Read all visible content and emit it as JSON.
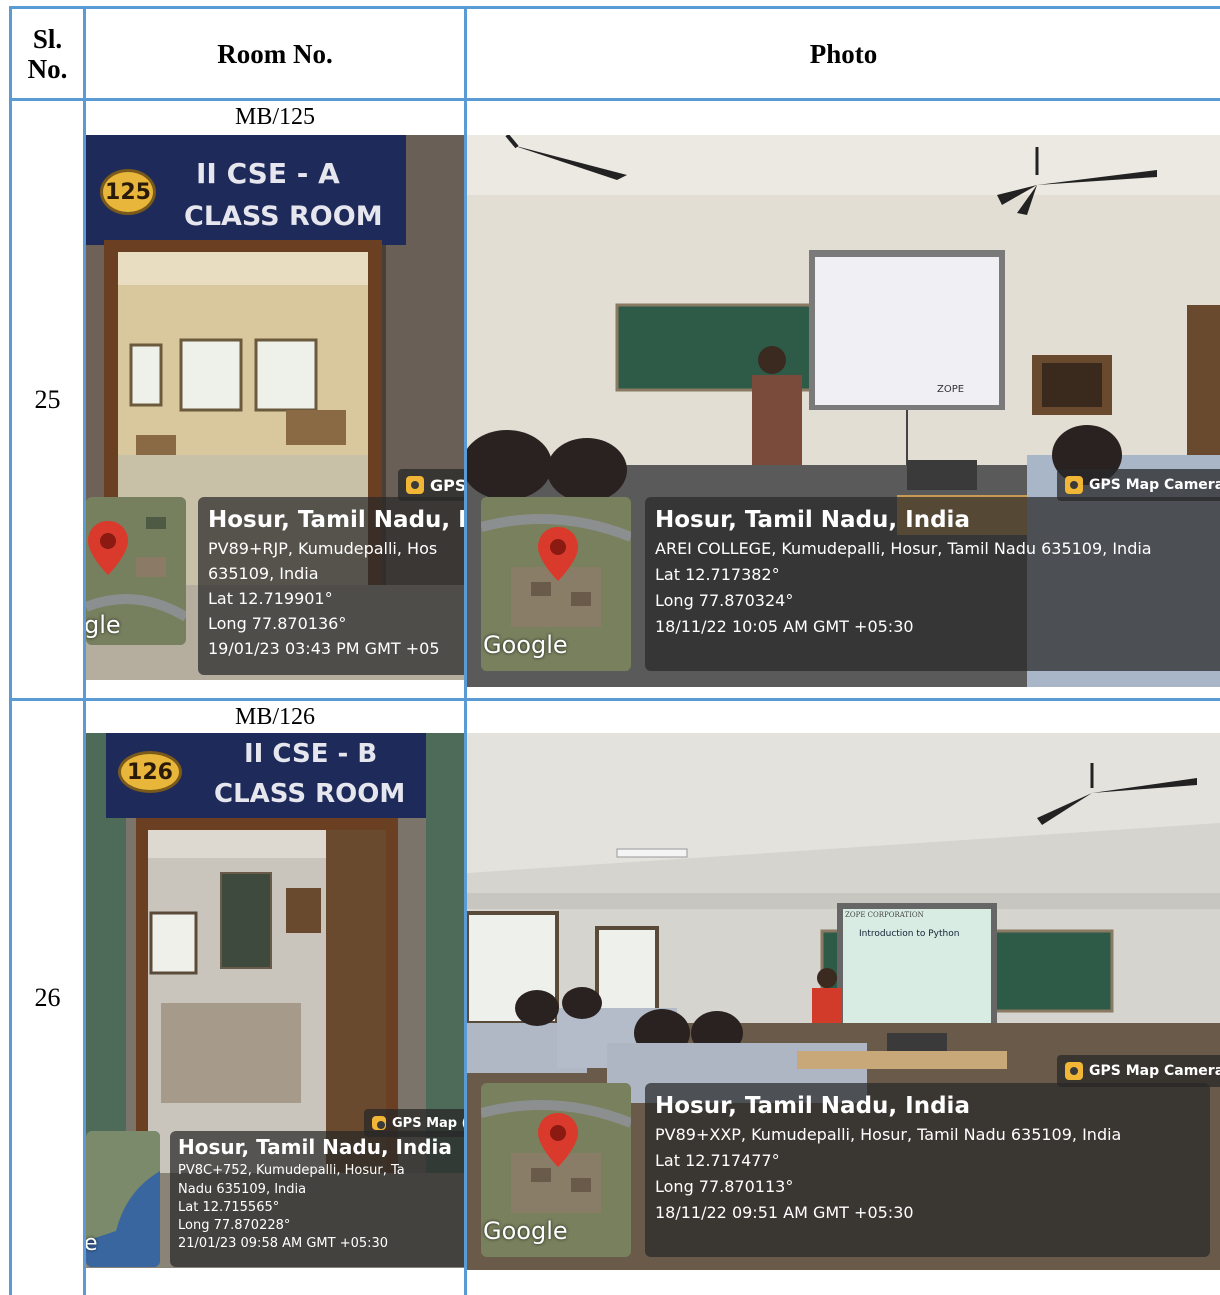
{
  "table": {
    "headers": {
      "sl_no": "Sl.\nNo.",
      "room_no": "Room No.",
      "photo": "Photo"
    },
    "rows": [
      {
        "sl_no": "25",
        "room_no": "MB/125",
        "door_photo": {
          "sign_number": "125",
          "sign_line1": "II CSE - A",
          "sign_line2": "CLASS ROOM",
          "badge": "GPS",
          "place": "Hosur, Tamil Nadu, Ir",
          "address1": "PV89+RJP, Kumudepalli, Hos",
          "address2": "635109, India",
          "lat": "Lat 12.719901°",
          "long": "Long 77.870136°",
          "datetime": "19/01/23 03:43 PM GMT +05",
          "google": "gle"
        },
        "class_photo": {
          "slide_text": "ZOPE",
          "badge": "GPS Map Camera",
          "place": "Hosur, Tamil Nadu, India",
          "address": "AREI COLLEGE, Kumudepalli, Hosur, Tamil Nadu 635109, India",
          "lat": "Lat 12.717382°",
          "long": "Long 77.870324°",
          "datetime": "18/11/22 10:05 AM GMT +05:30",
          "google": "Google"
        }
      },
      {
        "sl_no": "26",
        "room_no": "MB/126",
        "door_photo": {
          "sign_number": "126",
          "sign_line1": "II CSE - B",
          "sign_line2": "CLASS ROOM",
          "badge": "GPS Map (",
          "place": "Hosur, Tamil Nadu, India",
          "address1": "PV8C+752, Kumudepalli, Hosur, Ta",
          "address2": "Nadu 635109, India",
          "lat": "Lat 12.715565°",
          "long": "Long 77.870228°",
          "datetime": "21/01/23 09:58 AM GMT +05:30",
          "google": "e"
        },
        "class_photo": {
          "slide_title": "Introduction to Python",
          "slide_header": "ZOPE CORPORATION",
          "badge": "GPS Map Camera",
          "place": "Hosur, Tamil Nadu, India",
          "address": "PV89+XXP, Kumudepalli, Hosur, Tamil Nadu 635109, India",
          "lat": "Lat 12.717477°",
          "long": "Long 77.870113°",
          "datetime": "18/11/22 09:51 AM GMT +05:30",
          "google": "Google"
        }
      }
    ]
  },
  "colors": {
    "grid": "#5b9bd5",
    "overlay": "#282828",
    "sign_board": "#1e2a5a",
    "sign_circle": "#e8b63a",
    "pin": "#d93a2b"
  },
  "icons": [
    "map-pin-icon",
    "gps-camera-icon",
    "ceiling-fan-icon"
  ]
}
